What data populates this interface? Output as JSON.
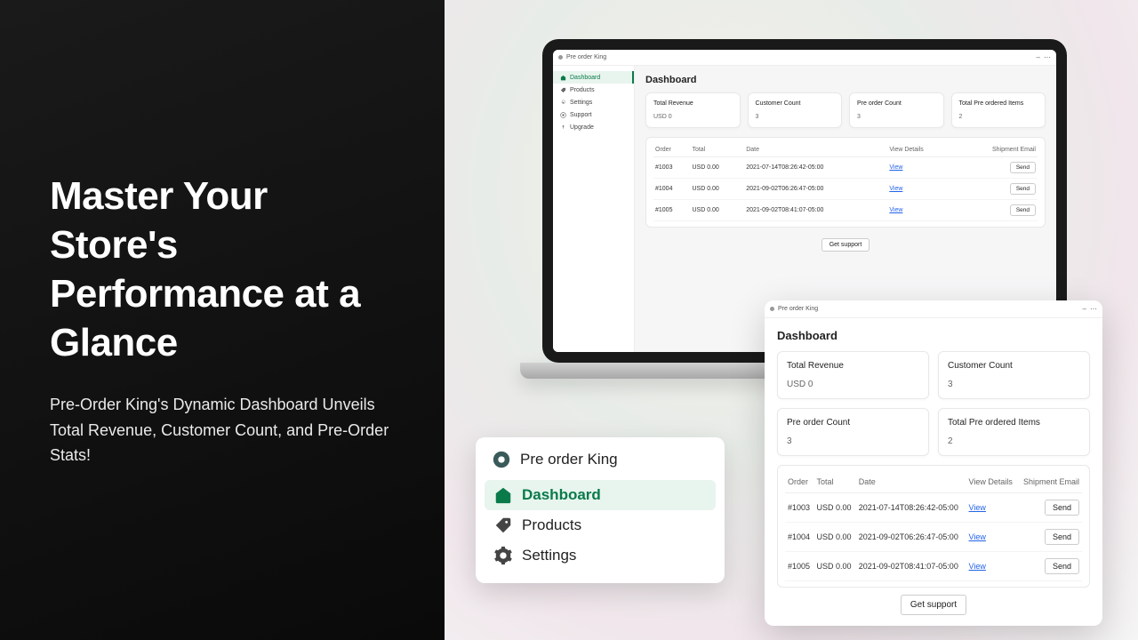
{
  "hero": {
    "title": "Master Your Store's Performance at a Glance",
    "subtitle": "Pre-Order King's Dynamic Dashboard Unveils Total Revenue, Customer Count, and Pre-Order Stats!"
  },
  "app": {
    "name": "Pre order King",
    "page_title": "Dashboard"
  },
  "sidebar": {
    "items": [
      {
        "icon": "home",
        "label": "Dashboard"
      },
      {
        "icon": "tag",
        "label": "Products"
      },
      {
        "icon": "gear",
        "label": "Settings"
      },
      {
        "icon": "support",
        "label": "Support"
      },
      {
        "icon": "upgrade",
        "label": "Upgrade"
      }
    ]
  },
  "stats": [
    {
      "label": "Total Revenue",
      "value": "USD 0"
    },
    {
      "label": "Customer Count",
      "value": "3"
    },
    {
      "label": "Pre order Count",
      "value": "3"
    },
    {
      "label": "Total Pre ordered Items",
      "value": "2"
    }
  ],
  "table": {
    "headers": {
      "order": "Order",
      "total": "Total",
      "date": "Date",
      "view": "View Details",
      "ship": "Shipment Email"
    },
    "view_link": "View",
    "send_label": "Send",
    "rows": [
      {
        "order": "#1003",
        "total": "USD 0.00",
        "date": "2021-07-14T08:26:42-05:00"
      },
      {
        "order": "#1004",
        "total": "USD 0.00",
        "date": "2021-09-02T06:26:47-05:00"
      },
      {
        "order": "#1005",
        "total": "USD 0.00",
        "date": "2021-09-02T08:41:07-05:00"
      }
    ]
  },
  "support_button": "Get support"
}
